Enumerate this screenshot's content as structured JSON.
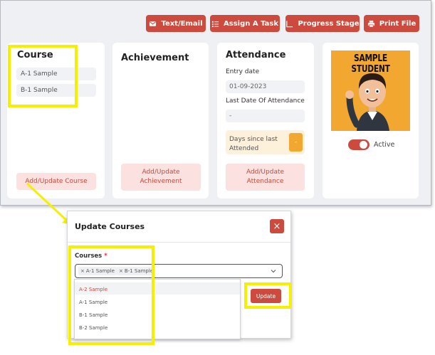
{
  "toolbar": {
    "text_email": "Text/Email",
    "assign_task": "Assign A Task",
    "progress_stage": "Progress Stage",
    "print_file": "Print File"
  },
  "course": {
    "title": "Course",
    "items": [
      "A-1 Sample",
      "B-1 Sample"
    ],
    "button": "Add/Update Course"
  },
  "achievement": {
    "title": "Achievement",
    "button_line1": "Add/Update",
    "button_line2": "Achievement"
  },
  "attendance": {
    "title": "Attendance",
    "entry_label": "Entry date",
    "entry_value": "01-09-2023",
    "last_label": "Last Date Of Attendance",
    "last_value": "-",
    "days_line1": "Days since last",
    "days_line2": "Attended",
    "days_value": "-",
    "button_line1": "Add/Update",
    "button_line2": "Attendance"
  },
  "profile": {
    "image_caption": "SAMPLE STUDENT",
    "status": "Active"
  },
  "modal": {
    "title": "Update Courses",
    "close": "×",
    "field_label": "Courses",
    "required_mark": "*",
    "selected_tags": [
      "A-1 Sample",
      "B-1 Sample"
    ],
    "tag_remove": "×",
    "options": [
      "A-2 Sample",
      "A-1 Sample",
      "B-1 Sample",
      "B-2 Sample"
    ],
    "update_button": "Update"
  },
  "colors": {
    "accent": "#cc4b3e",
    "highlight": "#f5f000",
    "profile_bg": "#f2a730"
  }
}
